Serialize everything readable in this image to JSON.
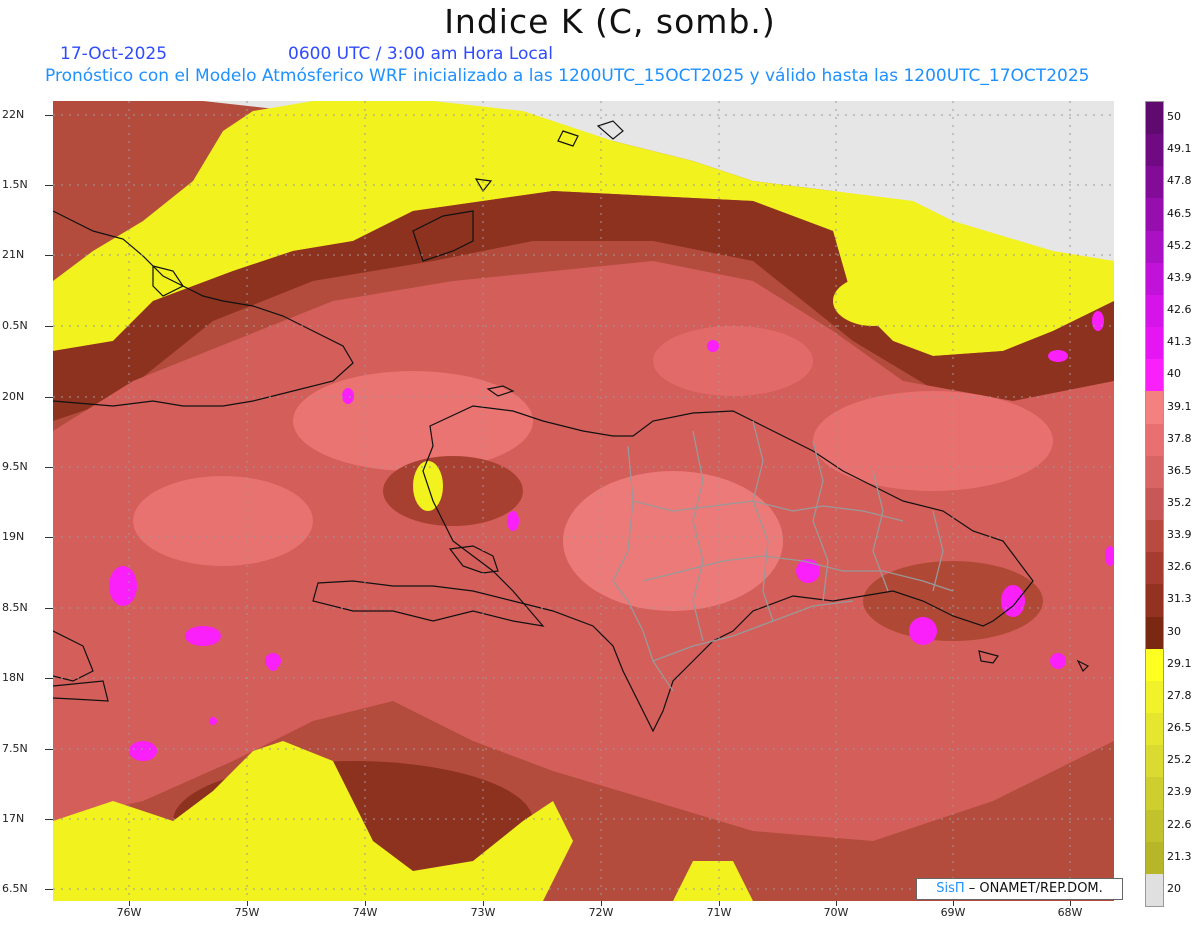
{
  "header": {
    "title": "Indice K (C, somb.)",
    "date": "17-Oct-2025",
    "time": "0600 UTC / 3:00 am Hora Local",
    "description": "Pronóstico con el Modelo Atmósferico WRF inicializado a las 1200UTC_15OCT2025 y válido hasta las  1200UTC_17OCT2025"
  },
  "axes": {
    "y_labels": [
      "22N",
      "1.5N",
      "21N",
      "0.5N",
      "20N",
      "9.5N",
      "19N",
      "8.5N",
      "18N",
      "7.5N",
      "17N",
      "6.5N"
    ],
    "x_labels": [
      "76W",
      "75W",
      "74W",
      "73W",
      "72W",
      "71W",
      "70W",
      "69W",
      "68W"
    ]
  },
  "colorbar": {
    "labels": [
      "50",
      "49.1",
      "47.8",
      "46.5",
      "45.2",
      "43.9",
      "42.6",
      "41.3",
      "40",
      "39.1",
      "37.8",
      "36.5",
      "35.2",
      "33.9",
      "32.6",
      "31.3",
      "30",
      "29.1",
      "27.8",
      "26.5",
      "25.2",
      "23.9",
      "22.6",
      "21.3",
      "20"
    ],
    "colors": [
      "#5e0a6e",
      "#6f0a82",
      "#820c98",
      "#960eae",
      "#aa10c4",
      "#c012d8",
      "#d414e8",
      "#e616f4",
      "#fa20fa",
      "#f48080",
      "#e87070",
      "#d86464",
      "#c85858",
      "#b84a40",
      "#a63c30",
      "#943222",
      "#7a2812",
      "#ffff22",
      "#f2f22a",
      "#e6e62e",
      "#dada30",
      "#cece2e",
      "#c2c22c",
      "#b6b628",
      "#e0e0e0"
    ]
  },
  "credit": {
    "brand": "SisΠ",
    "text": " – ONAMET/REP.DOM."
  },
  "palette": {
    "low_band": "#ffff1e",
    "moderate": "#aa4a3c",
    "high": "#d45e5a",
    "very_high": "#f08080",
    "extreme": "#fa20fa",
    "no_data": "#e6e6e6",
    "coast": "#111111",
    "provinces": "#999999"
  }
}
